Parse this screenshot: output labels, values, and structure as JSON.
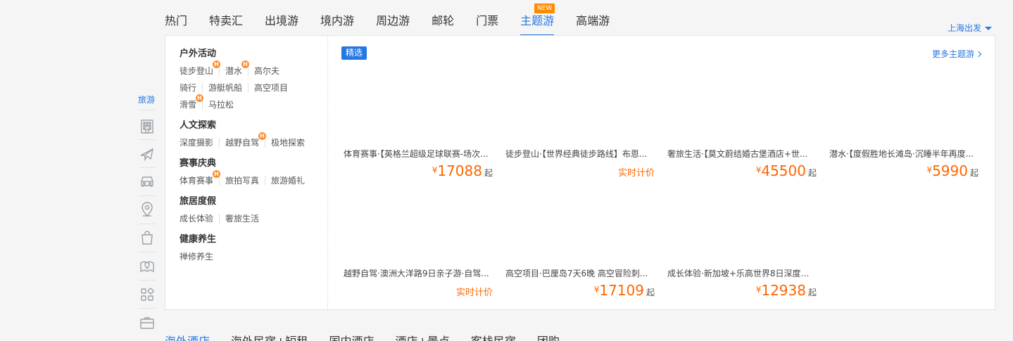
{
  "tabs": [
    "热门",
    "特卖汇",
    "出境游",
    "境内游",
    "周边游",
    "邮轮",
    "门票",
    "主题游",
    "高端游"
  ],
  "active_tab_index": 7,
  "new_badge": "NEW",
  "departure": "上海出发",
  "rail": {
    "label": "旅游",
    "icons": [
      "hotel-icon",
      "plane-icon",
      "car-icon",
      "location-pin-icon",
      "shopping-bag-icon",
      "map-pin-icon",
      "grid-apps-icon",
      "briefcase-icon"
    ]
  },
  "categories": [
    {
      "title": "户外活动",
      "items": [
        {
          "label": "徒步登山",
          "hot": true
        },
        {
          "label": "潜水",
          "hot": true
        },
        {
          "label": "高尔夫",
          "hot": false
        },
        {
          "label": "骑行",
          "hot": false
        },
        {
          "label": "游艇帆船",
          "hot": false
        },
        {
          "label": "高空项目",
          "hot": false
        },
        {
          "label": "滑雪",
          "hot": true
        },
        {
          "label": "马拉松",
          "hot": false
        }
      ]
    },
    {
      "title": "人文探索",
      "items": [
        {
          "label": "深度摄影",
          "hot": false
        },
        {
          "label": "越野自驾",
          "hot": true
        },
        {
          "label": "极地探索",
          "hot": false
        }
      ]
    },
    {
      "title": "赛事庆典",
      "items": [
        {
          "label": "体育赛事",
          "hot": true
        },
        {
          "label": "旅拍写真",
          "hot": false
        },
        {
          "label": "旅游婚礼",
          "hot": false
        }
      ]
    },
    {
      "title": "旅居度假",
      "items": [
        {
          "label": "成长体验",
          "hot": false
        },
        {
          "label": "奢旅生活",
          "hot": false
        }
      ]
    },
    {
      "title": "健康养生",
      "items": [
        {
          "label": "禅修养生",
          "hot": false
        }
      ]
    }
  ],
  "hot_badge": "H",
  "featured_label": "精选",
  "more_label": "更多主题游",
  "currency": "¥",
  "price_suffix": "起",
  "products_row1": [
    {
      "title": "体育赛事·【英格兰超级足球联赛-场次...",
      "price": "17088",
      "realtime": ""
    },
    {
      "title": "徒步登山·【世界经典徒步路线】布恩...",
      "price": "",
      "realtime": "实时计价"
    },
    {
      "title": "奢旅生活·【莫文蔚结婚古堡酒店+世...",
      "price": "45500",
      "realtime": ""
    },
    {
      "title": "潜水·【度假胜地长滩岛·沉睡半年再度...",
      "price": "5990",
      "realtime": ""
    }
  ],
  "products_row2": [
    {
      "title": "越野自驾·澳洲大洋路9日亲子游·自驾...",
      "price": "",
      "realtime": "实时计价"
    },
    {
      "title": "高空项目·巴厘岛7天6晚 高空冒险刺...",
      "price": "17109",
      "realtime": ""
    },
    {
      "title": "成长体验·新加坡+乐高世界8日深度亲...",
      "price": "12938",
      "realtime": ""
    }
  ],
  "bottom_tabs": [
    "海外酒店",
    "海外民宿+短租",
    "国内酒店",
    "酒店+景点",
    "客栈民宿",
    "团购"
  ]
}
